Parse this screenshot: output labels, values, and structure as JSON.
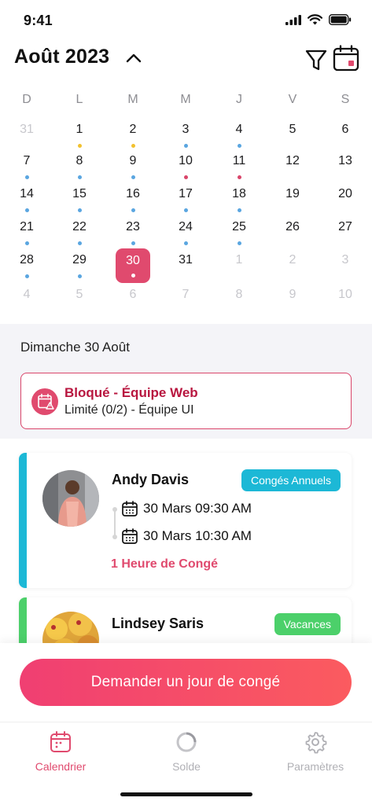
{
  "status": {
    "time": "9:41"
  },
  "header": {
    "month_title": "Août 2023",
    "icons": {
      "chevron": "chevron-up-icon",
      "filter": "filter-icon",
      "calendar": "calendar-icon"
    }
  },
  "calendar": {
    "weekdays": [
      "D",
      "L",
      "M",
      "M",
      "J",
      "V",
      "S"
    ],
    "weeks": [
      [
        {
          "d": "31",
          "m": true
        },
        {
          "d": "1",
          "dot": "yellow"
        },
        {
          "d": "2",
          "dot": "yellow"
        },
        {
          "d": "3",
          "dot": "blue"
        },
        {
          "d": "4",
          "dot": "blue"
        },
        {
          "d": "5"
        },
        {
          "d": "6"
        }
      ],
      [
        {
          "d": "7",
          "dot": "blue"
        },
        {
          "d": "8",
          "dot": "blue"
        },
        {
          "d": "9",
          "dot": "blue"
        },
        {
          "d": "10",
          "dot": "red"
        },
        {
          "d": "11",
          "dot": "red"
        },
        {
          "d": "12"
        },
        {
          "d": "13"
        }
      ],
      [
        {
          "d": "14",
          "dot": "blue"
        },
        {
          "d": "15",
          "dot": "blue"
        },
        {
          "d": "16",
          "dot": "blue"
        },
        {
          "d": "17",
          "dot": "blue"
        },
        {
          "d": "18",
          "dot": "blue"
        },
        {
          "d": "19"
        },
        {
          "d": "20"
        }
      ],
      [
        {
          "d": "21",
          "dot": "blue"
        },
        {
          "d": "22",
          "dot": "blue"
        },
        {
          "d": "23",
          "dot": "blue"
        },
        {
          "d": "24",
          "dot": "blue"
        },
        {
          "d": "25",
          "dot": "blue"
        },
        {
          "d": "26"
        },
        {
          "d": "27"
        }
      ],
      [
        {
          "d": "28",
          "dot": "blue"
        },
        {
          "d": "29",
          "dot": "blue"
        },
        {
          "d": "30",
          "dot": "white",
          "sel": true
        },
        {
          "d": "31"
        },
        {
          "d": "1",
          "m": true
        },
        {
          "d": "2",
          "m": true
        },
        {
          "d": "3",
          "m": true
        }
      ],
      [
        {
          "d": "4",
          "m": true
        },
        {
          "d": "5",
          "m": true
        },
        {
          "d": "6",
          "m": true
        },
        {
          "d": "7",
          "m": true
        },
        {
          "d": "8",
          "m": true
        },
        {
          "d": "9",
          "m": true
        },
        {
          "d": "10",
          "m": true
        }
      ]
    ]
  },
  "colors": {
    "accent": "#e04a6e",
    "dot_blue": "#5aa6e0",
    "dot_yellow": "#f2c12e",
    "dot_red": "#d9456a",
    "dot_white": "#ffffff",
    "cyan": "#1cb8d6",
    "green": "#4cd06a"
  },
  "selected_date": {
    "label": "Dimanche 30 Août"
  },
  "blocked": {
    "title": "Bloqué - Équipe Web",
    "subtitle": "Limité (0/2) - Équipe UI",
    "icon": "calendar-warning-icon"
  },
  "requests": [
    {
      "name": "Andy Davis",
      "badge": "Congés Annuels",
      "start": "30 Mars 09:30 AM",
      "end": "30 Mars 10:30 AM",
      "duration": "1 Heure de Congé"
    },
    {
      "name": "Lindsey Saris",
      "badge": "Vacances"
    }
  ],
  "actions": {
    "request_button": "Demander un jour de congé"
  },
  "tabs": [
    {
      "label": "Calendrier",
      "icon": "calendar-icon",
      "active": true
    },
    {
      "label": "Solde",
      "icon": "donut-chart-icon",
      "active": false
    },
    {
      "label": "Paramètres",
      "icon": "gear-icon",
      "active": false
    }
  ]
}
